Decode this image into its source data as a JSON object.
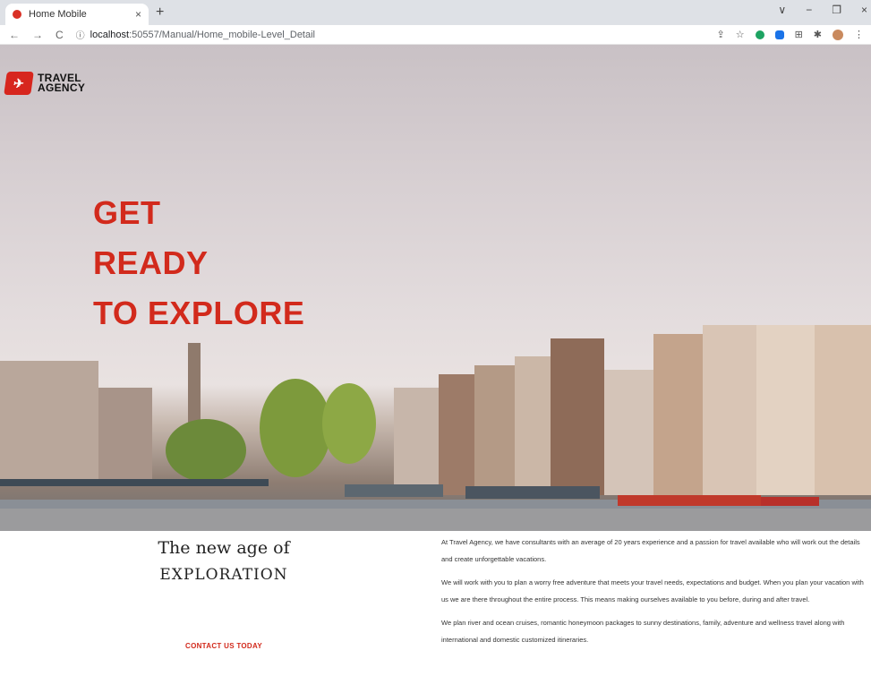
{
  "browser": {
    "tab_title": "Home Mobile",
    "tab_close": "×",
    "new_tab": "+",
    "url_host": "localhost",
    "url_path": ":50557/Manual/Home_mobile-Level_Detail",
    "back": "←",
    "forward": "→",
    "reload": "C",
    "info": "ⓘ",
    "window_controls": [
      "∨",
      "−",
      "❐",
      "×"
    ]
  },
  "logo": {
    "line1": "TRAVEL",
    "line2": "AGENCY"
  },
  "hero": {
    "lines": [
      "GET",
      "READY",
      "TO EXPLORE"
    ]
  },
  "intro": {
    "title_line1": "The new age of",
    "title_line2": "EXPLORATION",
    "cta": "CONTACT US TODAY"
  },
  "about": {
    "paragraphs": [
      "At Travel Agency, we have consultants with an average of 20 years experience and a passion for travel available who will work out the details and create unforgettable vacations.",
      "We will work with you to plan a worry free adventure that meets your travel needs, expectations and budget. When you plan your vacation with us we are there throughout the entire process. This means making ourselves available to you before, during and after travel.",
      "We plan river and ocean cruises, romantic honeymoon packages to sunny destinations, family, adventure and wellness travel along with international and domestic customized itineraries."
    ]
  },
  "colors": {
    "accent": "#d22a1c",
    "logo": "#d7261e"
  }
}
